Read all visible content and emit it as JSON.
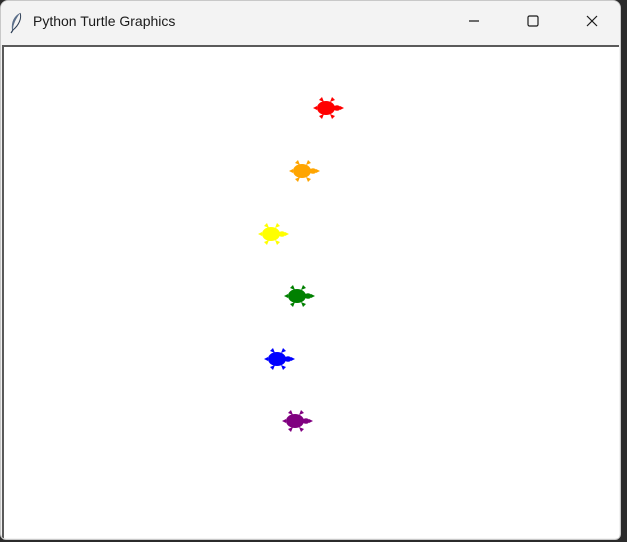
{
  "window": {
    "title": "Python Turtle Graphics",
    "app_icon": "feather-icon"
  },
  "controls": {
    "minimize_icon": "minimize-icon",
    "maximize_icon": "maximize-icon",
    "close_icon": "close-icon"
  },
  "canvas": {
    "background": "#ffffff",
    "turtles": [
      {
        "color": "red",
        "hex": "#ff0000",
        "icon": "turtle-icon"
      },
      {
        "color": "orange",
        "hex": "#ffa500",
        "icon": "turtle-icon"
      },
      {
        "color": "yellow",
        "hex": "#ffff00",
        "icon": "turtle-icon"
      },
      {
        "color": "green",
        "hex": "#008000",
        "icon": "turtle-icon"
      },
      {
        "color": "blue",
        "hex": "#0000ff",
        "icon": "turtle-icon"
      },
      {
        "color": "purple",
        "hex": "#800080",
        "icon": "turtle-icon"
      }
    ]
  }
}
